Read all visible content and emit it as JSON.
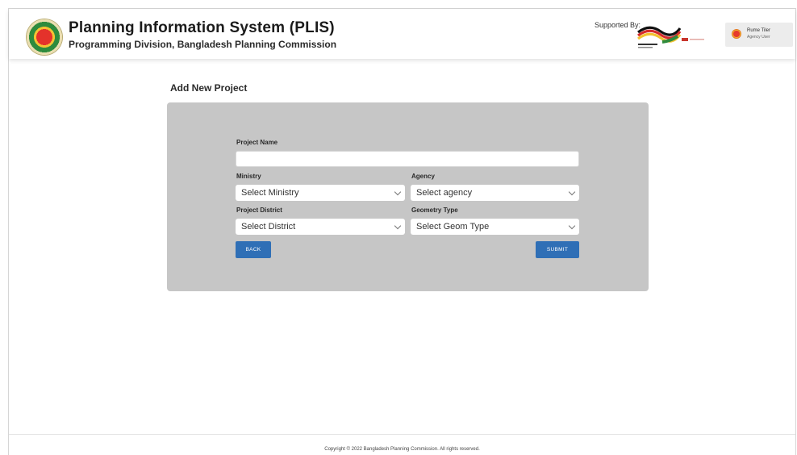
{
  "header": {
    "title": "Planning Information System (PLIS)",
    "subtitle": "Programming Division, Bangladesh Planning Commission",
    "supported_by": "Supported By:",
    "sponsor_marks": {
      "left_small": "german",
      "right_small": "giz"
    },
    "user": {
      "name": "Rume Tiler",
      "role": "Agency User"
    }
  },
  "page": {
    "heading": "Add New Project"
  },
  "form": {
    "project_name_label": "Project Name",
    "project_name_value": "",
    "ministry_label": "Ministry",
    "ministry_value": "Select Ministry",
    "agency_label": "Agency",
    "agency_value": "Select agency",
    "district_label": "Project District",
    "district_value": "Select District",
    "geometry_label": "Geometry Type",
    "geometry_value": "Select Geom Type",
    "back_label": "BACK",
    "submit_label": "SUBMIT"
  },
  "footer": {
    "copyright": "Copyright © 2022 Bangladesh Planning Commission. All rights reserved."
  },
  "colors": {
    "button": "#2f6fb6",
    "card": "#c6c6c6",
    "page_bg": "#ffffff"
  }
}
